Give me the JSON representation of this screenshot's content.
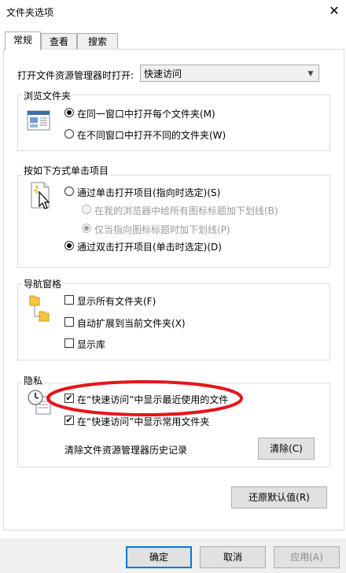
{
  "window": {
    "title": "文件夹选项"
  },
  "tabs": [
    {
      "label": "常规",
      "active": true
    },
    {
      "label": "查看",
      "active": false
    },
    {
      "label": "搜索",
      "active": false
    }
  ],
  "open_explorer": {
    "label": "打开文件资源管理器时打开:",
    "value": "快速访问"
  },
  "browse_folders": {
    "title": "浏览文件夹",
    "options": [
      {
        "label": "在同一窗口中打开每个文件夹(M)",
        "checked": true
      },
      {
        "label": "在不同窗口中打开不同的文件夹(W)",
        "checked": false
      }
    ]
  },
  "click_items": {
    "title": "按如下方式单击项目",
    "single": {
      "label": "通过单击打开项目(指向时选定)(S)",
      "checked": false
    },
    "sub_options": [
      {
        "label": "在我的浏览器中给所有图标标题加下划线(B)",
        "checked": false
      },
      {
        "label": "仅当指向图标标题时加下划线(P)",
        "checked": true
      }
    ],
    "double": {
      "label": "通过双击打开项目(单击时选定)(D)",
      "checked": true
    }
  },
  "navigation_pane": {
    "title": "导航窗格",
    "options": [
      {
        "label": "显示所有文件夹(F)",
        "checked": false
      },
      {
        "label": "自动扩展到当前文件夹(X)",
        "checked": false
      },
      {
        "label": "显示库",
        "checked": false
      }
    ]
  },
  "privacy": {
    "title": "隐私",
    "options": [
      {
        "label": "在“快速访问”中显示最近使用的文件",
        "checked": true
      },
      {
        "label": "在“快速访问”中显示常用文件夹",
        "checked": true
      }
    ],
    "clear_label": "清除文件资源管理器历史记录",
    "clear_button": "清除(C)"
  },
  "restore_defaults": "还原默认值(R)",
  "footer": {
    "ok": "确定",
    "cancel": "取消",
    "apply": "应用(A)"
  },
  "colors": {
    "annotation_ellipse": "#e8141a",
    "focus_border": "#0078d7"
  }
}
